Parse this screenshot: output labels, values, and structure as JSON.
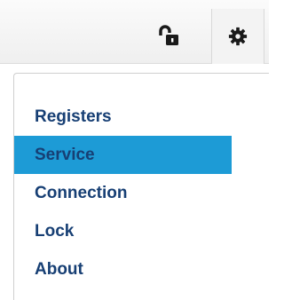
{
  "toolbar": {
    "lock_icon": "unlocked-padlock-icon",
    "settings_icon": "gear-icon"
  },
  "menu": {
    "items": [
      {
        "label": "Registers",
        "active": false
      },
      {
        "label": "Service",
        "active": true
      },
      {
        "label": "Connection",
        "active": false
      },
      {
        "label": "Lock",
        "active": false
      },
      {
        "label": "About",
        "active": false
      }
    ]
  },
  "colors": {
    "accent": "#1d9bd6",
    "menu_text": "#173f74",
    "icon": "#1a1a1a"
  }
}
